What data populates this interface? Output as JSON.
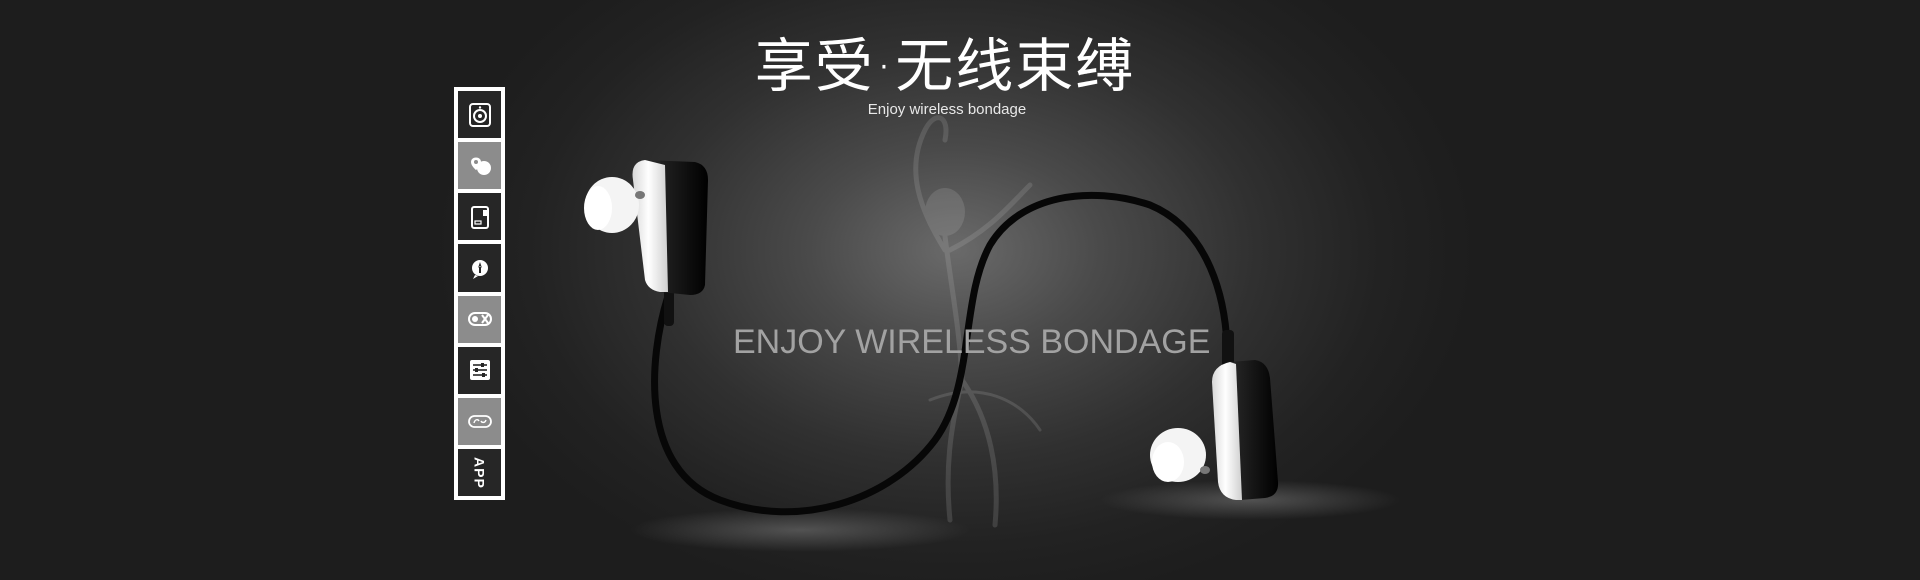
{
  "banner": {
    "headline": "享受·无线束缚",
    "subheadline": "Enjoy wireless bondage",
    "tagline": "ENJOY WIRELESS BONDAGE"
  },
  "feature_strip": {
    "items": [
      {
        "icon": "speaker-icon",
        "shade": "dark"
      },
      {
        "icon": "location-pin-icon",
        "shade": "light"
      },
      {
        "icon": "device-card-icon",
        "shade": "dark"
      },
      {
        "icon": "chat-bubble-icon",
        "shade": "dark"
      },
      {
        "icon": "mute-toggle-icon",
        "shade": "light"
      },
      {
        "icon": "equalizer-icon",
        "shade": "dark"
      },
      {
        "icon": "link-chain-icon",
        "shade": "light"
      },
      {
        "icon": "app-text-icon",
        "shade": "dark",
        "label": "APP"
      }
    ]
  },
  "colors": {
    "background": "#1f1f1f",
    "spotlight": "#6a6a6a",
    "cable": "#0a0a0a",
    "earbud_white": "#f2f2f2",
    "tagline_grey": "#a2a2a2",
    "strip_border": "#ffffff"
  }
}
